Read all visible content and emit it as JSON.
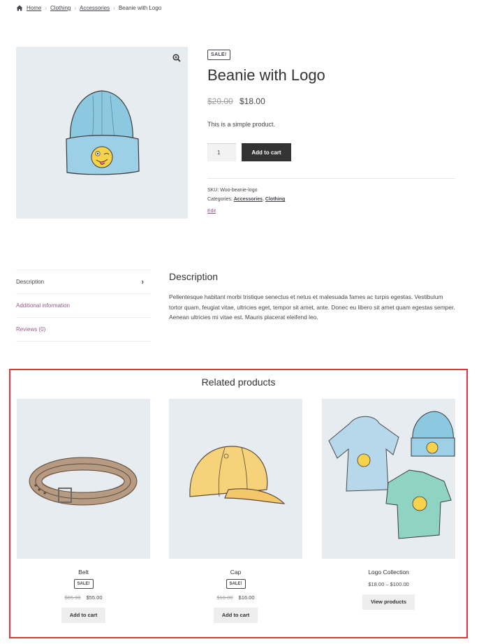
{
  "breadcrumb": {
    "home": "Home",
    "crumb1": "Clothing",
    "crumb2": "Accessories",
    "current": "Beanie with Logo",
    "separator": "›"
  },
  "product": {
    "sale_badge": "SALE!",
    "title": "Beanie with Logo",
    "old_price": "$20.00",
    "price": "$18.00",
    "short_description": "This is a simple product.",
    "quantity": "1",
    "add_to_cart": "Add to cart",
    "sku_label": "SKU:",
    "sku": "Woo-beanie-logo",
    "categories_label": "Categories:",
    "category1": "Accessories",
    "category_sep": ",",
    "category2": "Clothing",
    "edit": "Edit"
  },
  "tabs": [
    {
      "label": "Description",
      "active": true
    },
    {
      "label": "Additional information",
      "active": false
    },
    {
      "label": "Reviews (0)",
      "active": false
    }
  ],
  "description": {
    "title": "Description",
    "text": "Pellentesque habitant morbi tristique senectus et netus et malesuada fames ac turpis egestas. Vestibulum tortor quam, feugiat vitae, ultricies eget, tempor sit amet, ante. Donec eu libero sit amet quam egestas semper. Aenean ultricies mi vitae est. Mauris placerat eleifend leo."
  },
  "related": {
    "title": "Related products",
    "items": [
      {
        "name": "Belt",
        "badge": "SALE!",
        "old_price": "$65.00",
        "price": "$55.00",
        "button": "Add to cart"
      },
      {
        "name": "Cap",
        "badge": "SALE!",
        "old_price": "$18.00",
        "price": "$16.00",
        "button": "Add to cart"
      },
      {
        "name": "Logo Collection",
        "price": "$18.00 – $100.00",
        "button": "View products"
      }
    ]
  },
  "colors": {
    "accent_purple": "#96588a",
    "highlight_border": "#e0353b",
    "dark_button": "#333333",
    "image_bg": "#e6ecf0"
  },
  "icons": [
    "home-icon",
    "zoom-icon",
    "chevron-right-icon"
  ]
}
